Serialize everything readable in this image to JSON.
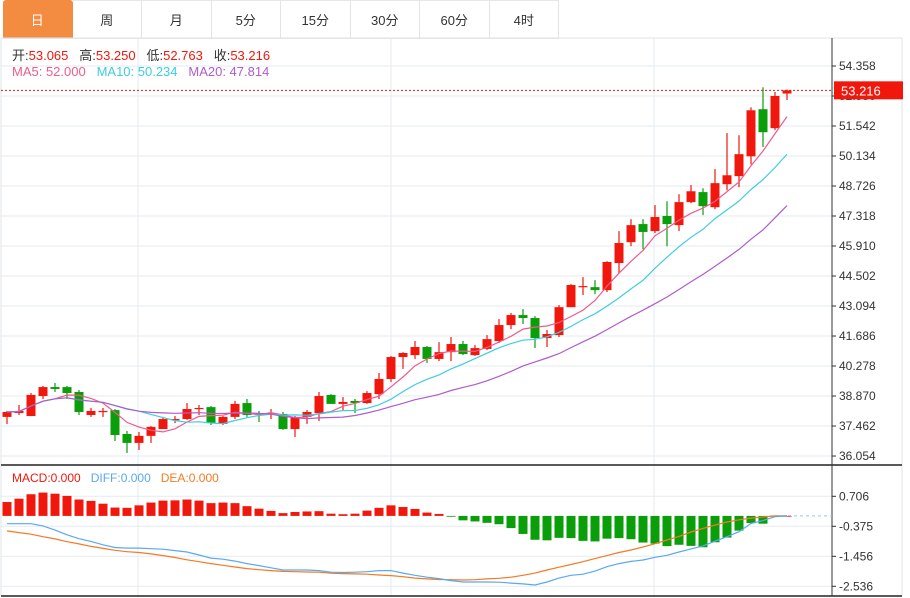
{
  "tabs": [
    {
      "label": "日",
      "active": true
    },
    {
      "label": "周"
    },
    {
      "label": "月"
    },
    {
      "label": "5分"
    },
    {
      "label": "15分"
    },
    {
      "label": "30分"
    },
    {
      "label": "60分"
    },
    {
      "label": "4时"
    }
  ],
  "ohlc_info": {
    "open_label": "开:",
    "open": "53.065",
    "high_label": "高:",
    "high": "53.250",
    "low_label": "低:",
    "low": "52.763",
    "close_label": "收:",
    "close": "53.216"
  },
  "ma_info": {
    "ma5": "MA5: 52.000",
    "ma10": "MA10: 50.234",
    "ma20": "MA20: 47.814"
  },
  "macd_info": {
    "macd": "MACD:0.000",
    "diff": "DIFF:0.000",
    "dea": "DEA:0.000"
  },
  "colors": {
    "up": "#f0180c",
    "down": "#0a9e0a",
    "ma5": "#ee5c8a",
    "ma10": "#3ecde0",
    "ma20": "#b05ccb",
    "diff": "#5aa9ee",
    "dea": "#f47a23",
    "tab_active": "#f38c40"
  },
  "chart_data": [
    {
      "type": "candlestick",
      "price_axis_ticks": [
        "54.358",
        "52.950",
        "51.542",
        "50.134",
        "48.726",
        "47.318",
        "45.910",
        "44.502",
        "43.094",
        "41.686",
        "40.278",
        "38.870",
        "37.462",
        "36.054"
      ],
      "ylim": [
        36.054,
        54.358
      ],
      "last_price": "53.216",
      "candles": [
        [
          37.89,
          38.17,
          37.56,
          38.12
        ],
        [
          38.07,
          38.45,
          37.98,
          38.17
        ],
        [
          37.93,
          39.01,
          37.93,
          38.92
        ],
        [
          38.87,
          39.34,
          38.73,
          39.29
        ],
        [
          39.29,
          39.48,
          39.06,
          39.2
        ],
        [
          39.29,
          39.34,
          38.73,
          39.01
        ],
        [
          39.06,
          39.15,
          37.98,
          38.12
        ],
        [
          37.98,
          38.31,
          37.89,
          38.17
        ],
        [
          38.12,
          38.31,
          37.89,
          38.17
        ],
        [
          38.21,
          38.26,
          36.76,
          37.04
        ],
        [
          37.09,
          37.23,
          36.2,
          36.67
        ],
        [
          36.67,
          37.18,
          36.34,
          37.0
        ],
        [
          37.0,
          37.46,
          36.67,
          37.42
        ],
        [
          37.32,
          37.89,
          37.32,
          37.79
        ],
        [
          37.75,
          37.93,
          37.6,
          37.79
        ],
        [
          37.79,
          38.54,
          37.75,
          38.26
        ],
        [
          38.26,
          38.45,
          37.98,
          38.31
        ],
        [
          38.35,
          38.4,
          37.51,
          37.6
        ],
        [
          37.56,
          37.93,
          37.51,
          37.89
        ],
        [
          37.89,
          38.64,
          37.79,
          38.5
        ],
        [
          38.54,
          38.73,
          37.89,
          37.98
        ],
        [
          38.07,
          38.17,
          37.65,
          38.03
        ],
        [
          38.03,
          38.26,
          37.79,
          38.07
        ],
        [
          38.03,
          38.12,
          37.28,
          37.32
        ],
        [
          37.32,
          37.93,
          36.95,
          37.89
        ],
        [
          37.89,
          38.21,
          37.56,
          38.12
        ],
        [
          38.07,
          39.06,
          37.7,
          38.87
        ],
        [
          38.92,
          38.96,
          38.5,
          38.5
        ],
        [
          38.5,
          38.82,
          38.21,
          38.59
        ],
        [
          38.64,
          38.73,
          38.07,
          38.54
        ],
        [
          38.54,
          39.1,
          38.5,
          39.01
        ],
        [
          38.96,
          39.95,
          38.73,
          39.67
        ],
        [
          39.67,
          40.75,
          39.53,
          40.7
        ],
        [
          40.7,
          40.93,
          40.14,
          40.89
        ],
        [
          40.79,
          41.45,
          40.61,
          41.17
        ],
        [
          41.17,
          41.22,
          40.42,
          40.61
        ],
        [
          40.61,
          41.4,
          40.51,
          40.93
        ],
        [
          40.93,
          41.64,
          40.51,
          41.31
        ],
        [
          41.31,
          41.45,
          40.79,
          40.84
        ],
        [
          40.79,
          41.26,
          40.75,
          41.12
        ],
        [
          41.08,
          41.73,
          41.03,
          41.54
        ],
        [
          41.45,
          42.48,
          41.36,
          42.2
        ],
        [
          42.2,
          42.77,
          42.01,
          42.67
        ],
        [
          42.67,
          42.95,
          42.25,
          42.53
        ],
        [
          42.53,
          42.62,
          41.12,
          41.59
        ],
        [
          41.59,
          41.97,
          41.17,
          41.78
        ],
        [
          41.73,
          43.14,
          41.64,
          43.04
        ],
        [
          43.04,
          44.12,
          43.04,
          44.08
        ],
        [
          43.98,
          44.45,
          43.61,
          44.03
        ],
        [
          43.98,
          44.31,
          43.65,
          43.84
        ],
        [
          43.84,
          45.2,
          43.75,
          45.16
        ],
        [
          45.11,
          46.61,
          44.64,
          46.05
        ],
        [
          46.09,
          47.17,
          45.9,
          46.89
        ],
        [
          46.94,
          47.17,
          45.76,
          46.57
        ],
        [
          46.61,
          47.83,
          46.52,
          47.27
        ],
        [
          47.32,
          48.01,
          45.9,
          46.94
        ],
        [
          46.89,
          48.34,
          46.61,
          47.97
        ],
        [
          47.97,
          48.77,
          47.92,
          48.48
        ],
        [
          48.44,
          48.62,
          47.36,
          47.78
        ],
        [
          47.73,
          49.52,
          47.64,
          48.86
        ],
        [
          48.81,
          51.21,
          48.53,
          49.23
        ],
        [
          49.19,
          51.11,
          48.67,
          50.22
        ],
        [
          50.12,
          52.42,
          49.74,
          52.28
        ],
        [
          52.33,
          53.36,
          50.56,
          51.25
        ],
        [
          51.44,
          53.14,
          51.35,
          52.95
        ],
        [
          53.065,
          53.25,
          52.763,
          53.216
        ]
      ],
      "candle_format": [
        "open",
        "high",
        "low",
        "close"
      ],
      "moving_averages": [
        "MA5",
        "MA10",
        "MA20"
      ]
    },
    {
      "type": "bar+line",
      "macd_axis_ticks": [
        "0.706",
        "-0.375",
        "-1.456",
        "-2.536"
      ],
      "ylim": [
        -2.75,
        1.0
      ],
      "macd_hist": [
        0.5,
        0.62,
        0.78,
        0.84,
        0.8,
        0.72,
        0.59,
        0.54,
        0.44,
        0.3,
        0.29,
        0.38,
        0.48,
        0.55,
        0.56,
        0.59,
        0.55,
        0.46,
        0.48,
        0.46,
        0.35,
        0.26,
        0.18,
        0.1,
        0.14,
        0.16,
        0.17,
        0.08,
        0.06,
        0.08,
        0.19,
        0.29,
        0.38,
        0.32,
        0.25,
        0.12,
        0.07,
        -0.01,
        -0.16,
        -0.2,
        -0.25,
        -0.3,
        -0.44,
        -0.65,
        -0.86,
        -0.88,
        -0.79,
        -0.8,
        -0.9,
        -0.92,
        -0.82,
        -0.8,
        -0.84,
        -0.96,
        -1.0,
        -1.09,
        -1.04,
        -1.08,
        -1.13,
        -0.95,
        -0.78,
        -0.53,
        -0.26,
        -0.28,
        -0.01,
        0.0
      ],
      "diff": [
        -0.28,
        -0.28,
        -0.28,
        -0.36,
        -0.51,
        -0.68,
        -0.82,
        -0.92,
        -1.04,
        -1.14,
        -1.16,
        -1.16,
        -1.18,
        -1.2,
        -1.25,
        -1.3,
        -1.41,
        -1.52,
        -1.56,
        -1.63,
        -1.72,
        -1.79,
        -1.87,
        -1.95,
        -1.95,
        -1.95,
        -1.97,
        -2.03,
        -2.04,
        -2.03,
        -2.01,
        -1.97,
        -1.97,
        -2.06,
        -2.14,
        -2.21,
        -2.26,
        -2.33,
        -2.38,
        -2.38,
        -2.38,
        -2.39,
        -2.42,
        -2.45,
        -2.49,
        -2.38,
        -2.24,
        -2.14,
        -2.1,
        -1.99,
        -1.83,
        -1.72,
        -1.64,
        -1.59,
        -1.49,
        -1.42,
        -1.3,
        -1.19,
        -1.08,
        -0.91,
        -0.75,
        -0.57,
        -0.27,
        -0.17,
        -0.03,
        0.0
      ],
      "dea": [
        -0.54,
        -0.6,
        -0.66,
        -0.75,
        -0.83,
        -0.93,
        -1.01,
        -1.1,
        -1.17,
        -1.24,
        -1.29,
        -1.32,
        -1.37,
        -1.43,
        -1.5,
        -1.58,
        -1.65,
        -1.72,
        -1.78,
        -1.84,
        -1.9,
        -1.94,
        -1.97,
        -2.0,
        -2.01,
        -2.02,
        -2.03,
        -2.06,
        -2.08,
        -2.09,
        -2.1,
        -2.13,
        -2.15,
        -2.19,
        -2.24,
        -2.27,
        -2.29,
        -2.3,
        -2.31,
        -2.3,
        -2.27,
        -2.25,
        -2.21,
        -2.14,
        -2.06,
        -1.95,
        -1.85,
        -1.75,
        -1.65,
        -1.54,
        -1.43,
        -1.32,
        -1.23,
        -1.12,
        -1.0,
        -0.87,
        -0.74,
        -0.58,
        -0.45,
        -0.33,
        -0.22,
        -0.14,
        -0.08,
        -0.04,
        0.0,
        0.0
      ]
    }
  ]
}
